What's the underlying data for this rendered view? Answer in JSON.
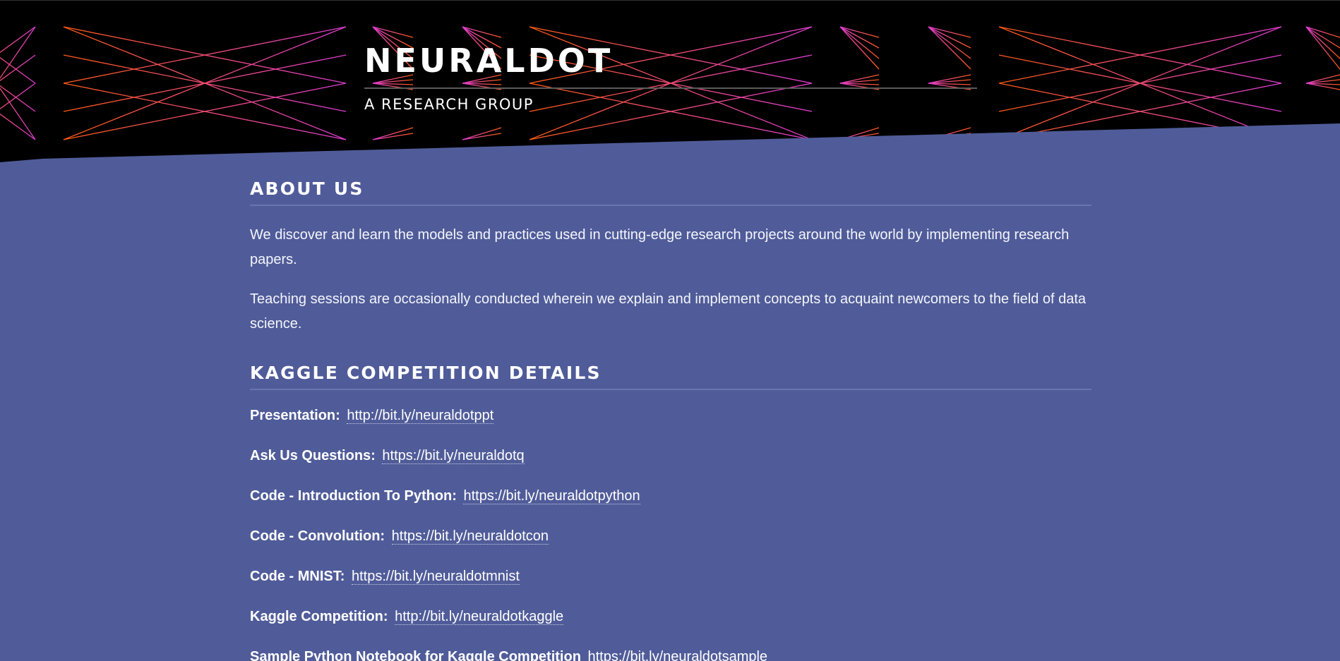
{
  "header": {
    "title": "NEURALDOT",
    "subtitle": "A RESEARCH GROUP"
  },
  "about": {
    "heading": "ABOUT US",
    "paragraphs": [
      "We discover and learn the models and practices used in cutting-edge research projects around the world by implementing research papers.",
      "Teaching sessions are occasionally conducted wherein we explain and implement concepts to acquaint newcomers to the field of data science."
    ]
  },
  "kaggle": {
    "heading": "KAGGLE COMPETITION DETAILS",
    "links": [
      {
        "label": "Presentation:",
        "url": "http://bit.ly/neuraldotppt"
      },
      {
        "label": "Ask Us Questions:",
        "url": "https://bit.ly/neuraldotq"
      },
      {
        "label": "Code - Introduction To Python:",
        "url": "https://bit.ly/neuraldotpython"
      },
      {
        "label": "Code - Convolution:",
        "url": "https://bit.ly/neuraldotcon"
      },
      {
        "label": "Code - MNIST:",
        "url": "https://bit.ly/neuraldotmnist"
      },
      {
        "label": "Kaggle Competition:",
        "url": "http://bit.ly/neuraldotkaggle"
      },
      {
        "label": "Sample Python Notebook for Kaggle Competition",
        "url": "https://bit.ly/neuraldotsample"
      }
    ]
  },
  "colors": {
    "background": "#505c99",
    "header_bg": "#000000",
    "pattern_orange": "#ff5a14",
    "pattern_magenta": "#e040c8",
    "rule": "#6a75ad"
  }
}
